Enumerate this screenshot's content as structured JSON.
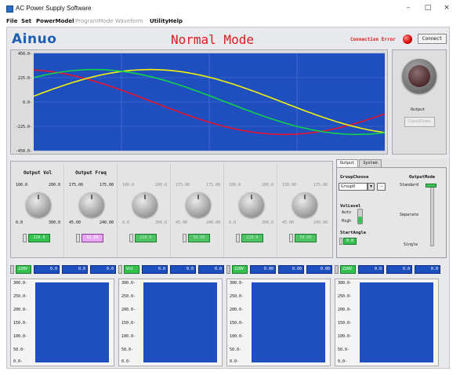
{
  "window": {
    "title": "AC Power Supply Software",
    "minimize": "–",
    "maximize": "□",
    "close": "×"
  },
  "menu": [
    {
      "label": "File",
      "enabled": true
    },
    {
      "label": "Set",
      "enabled": true
    },
    {
      "label": "PowerModel",
      "enabled": true
    },
    {
      "label": "ProgramMode",
      "enabled": false
    },
    {
      "label": "Waveform",
      "enabled": false
    },
    {
      "label": "Utility",
      "enabled": true
    },
    {
      "label": "Help",
      "enabled": true
    }
  ],
  "header": {
    "logo": "Ainuo",
    "mode": "Normal Mode",
    "connection_error": "Connection Error",
    "connect_button": "Connect"
  },
  "waveform_chart": {
    "y_ticks": [
      "450.0-",
      "225.0-",
      "0.0-",
      "-225.0-",
      "-450.0-"
    ],
    "ylim": [
      -450,
      450
    ],
    "background": "#1f4fbf",
    "series_colors": [
      "#e8142e",
      "#f4f20a",
      "#12d24a"
    ]
  },
  "output_panel": {
    "label": "Output",
    "countdown": "CountDown"
  },
  "knobs": [
    {
      "title": "Output Vol",
      "min": "100.0",
      "max": "200.0",
      "low": "0.0",
      "high": "300.0",
      "value": "220.0",
      "dim": false
    },
    {
      "title": "Output Freq",
      "min": "175.00",
      "max": "175.00",
      "low": "45.00",
      "high": "240.00",
      "value": "52.00",
      "dim": false
    },
    {
      "title": "",
      "min": "100.0",
      "max": "200.0",
      "low": "0.0",
      "high": "300.0",
      "value": "220.0",
      "dim": true
    },
    {
      "title": "",
      "min": "175.00",
      "max": "175.00",
      "low": "45.00",
      "high": "240.00",
      "value": "50.00",
      "dim": true
    },
    {
      "title": "",
      "min": "100.0",
      "max": "200.0",
      "low": "0.0",
      "high": "300.0",
      "value": "220.0",
      "dim": true
    },
    {
      "title": "",
      "min": "150.00",
      "max": "175.00",
      "low": "45.00",
      "high": "240.00",
      "value": "50.00",
      "dim": true
    }
  ],
  "settings": {
    "tabs": [
      "Output",
      "System"
    ],
    "group_choose_label": "GroupChoose",
    "group_value": "Group0",
    "dots": "...",
    "vol_level_label": "VolLevel",
    "auto": "Auto",
    "high": "High",
    "start_angle_label": "StartAngle",
    "start_angle_value": "0.0",
    "output_mode_label": "OutputMode",
    "modes": [
      "Standard",
      "Separate",
      "Single"
    ]
  },
  "meters": [
    {
      "label": "220V",
      "v1": "0.0",
      "v2": "0.0",
      "v3": "0.0"
    },
    {
      "label": "Vol",
      "v1": "0.0",
      "v2": "0.0",
      "v3": "0.0"
    },
    {
      "label": "220V",
      "v1": "0.00",
      "v2": "0.00",
      "v3": "0.00"
    },
    {
      "label": "220V",
      "v1": "0.0",
      "v2": "0.0",
      "v3": "0.0"
    }
  ],
  "mini_y_ticks": [
    "300.0-",
    "250.0-",
    "200.0-",
    "150.0-",
    "100.0-",
    "50.0-",
    "0.0-"
  ]
}
